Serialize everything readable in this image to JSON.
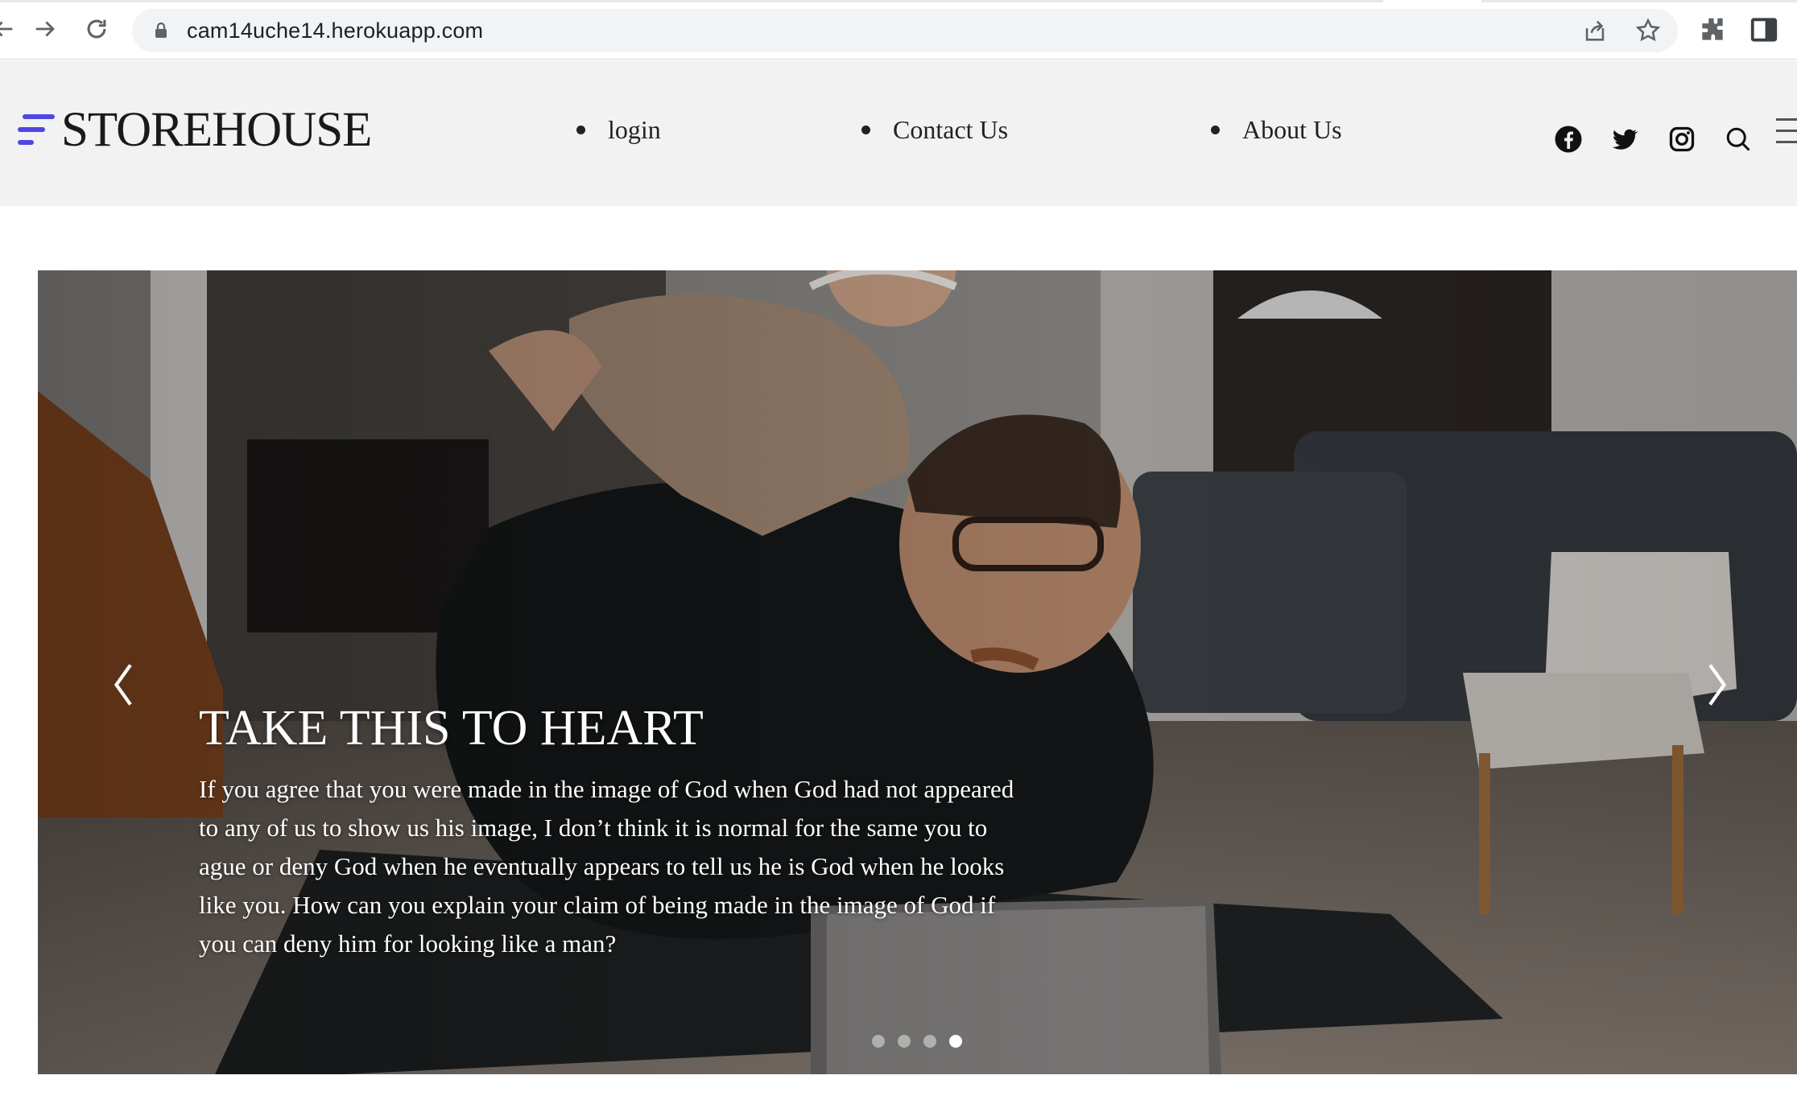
{
  "browser": {
    "url": "cam14uche14.herokuapp.com"
  },
  "header": {
    "logo_text": "STOREHOUSE",
    "nav": [
      {
        "label": "login"
      },
      {
        "label": "Contact Us"
      },
      {
        "label": "About Us"
      }
    ],
    "icons": [
      "facebook-icon",
      "twitter-icon",
      "instagram-icon",
      "search-icon",
      "menu-icon"
    ],
    "accent_color": "#4f46e5"
  },
  "hero": {
    "title": "TAKE THIS TO HEART",
    "body": "If you agree that you were made in the image of God when God had not appeared to any of us to show us his image, I don’t think it is normal for the same you to ague or deny God when he eventually appears to tell us he is God when he looks like you. How can you explain your claim of being made in the image of God if you can deny him for looking like a man?",
    "slides_count": 4,
    "active_slide": 4
  }
}
